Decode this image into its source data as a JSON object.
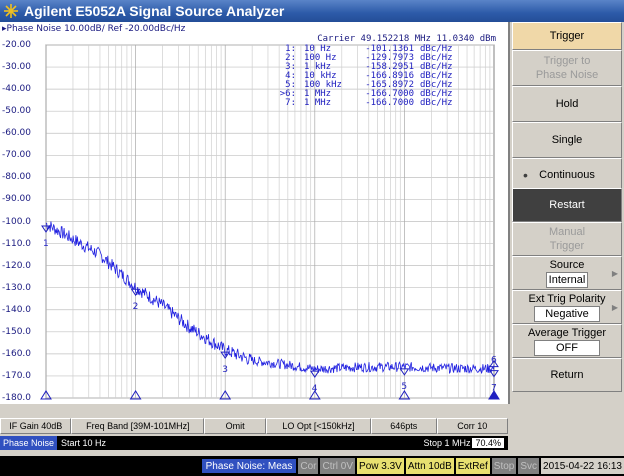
{
  "window": {
    "title": "Agilent E5052A Signal Source Analyzer"
  },
  "plot": {
    "header": "▸Phase Noise 10.00dB/ Ref -20.00dBc/Hz",
    "carrier": "Carrier 49.152218 MHz     11.0340 dBm",
    "y_ticks": [
      "-20.00",
      "-30.00",
      "-40.00",
      "-50.00",
      "-60.00",
      "-70.00",
      "-80.00",
      "-90.00",
      "-100.0",
      "-110.0",
      "-120.0",
      "-130.0",
      "-140.0",
      "-150.0",
      "-160.0",
      "-170.0",
      "-180.0"
    ],
    "markers": [
      {
        "id": "1:",
        "freq": "10 Hz",
        "val": "-101.1361",
        "unit": "dBc/Hz",
        "label": "1"
      },
      {
        "id": "2:",
        "freq": "100 Hz",
        "val": "-129.7973",
        "unit": "dBc/Hz",
        "label": "2"
      },
      {
        "id": "3:",
        "freq": "1 kHz",
        "val": "-158.2951",
        "unit": "dBc/Hz",
        "label": "3"
      },
      {
        "id": "4:",
        "freq": "10 kHz",
        "val": "-166.8916",
        "unit": "dBc/Hz",
        "label": "4"
      },
      {
        "id": "5:",
        "freq": "100 kHz",
        "val": "-165.8972",
        "unit": "dBc/Hz",
        "label": "5"
      },
      {
        "id": ">6:",
        "freq": "1 MHz",
        "val": "-166.7000",
        "unit": "dBc/Hz",
        "label": "6"
      },
      {
        "id": "7:",
        "freq": "1 MHz",
        "val": "-166.7000",
        "unit": "dBc/Hz",
        "label": "7"
      }
    ]
  },
  "chart_data": {
    "type": "line",
    "x_scale": "log",
    "xlim": [
      10,
      1000000
    ],
    "ylim": [
      -180,
      -20
    ],
    "ylabel": "dBc/Hz",
    "series": [
      {
        "x": [
          10,
          20,
          40,
          100,
          200,
          400,
          1000,
          2000,
          5000,
          10000,
          30000,
          100000,
          300000,
          1000000
        ],
        "y": [
          -101,
          -108,
          -115,
          -129.8,
          -138,
          -148,
          -158.3,
          -163,
          -165,
          -166.9,
          -166,
          -165.9,
          -166.5,
          -166.7
        ]
      }
    ],
    "marker_points": [
      {
        "label": "1",
        "x": 10,
        "y": -101.1361
      },
      {
        "label": "2",
        "x": 100,
        "y": -129.7973
      },
      {
        "label": "3",
        "x": 1000,
        "y": -158.2951
      },
      {
        "label": "4",
        "x": 10000,
        "y": -166.8916
      },
      {
        "label": "5",
        "x": 100000,
        "y": -165.8972
      },
      {
        "label": "6",
        "x": 1000000,
        "y": -166.7
      },
      {
        "label": "7",
        "x": 1000000,
        "y": -166.7
      }
    ]
  },
  "status1": {
    "if_gain": "IF Gain 40dB",
    "freq_band": "Freq Band [39M-101MHz]",
    "omit": "Omit",
    "lo_opt": "LO Opt [<150kHz]",
    "pts": "646pts",
    "corr": "Corr 10"
  },
  "status2": {
    "channel": "Phase Noise",
    "start": "Start 10 Hz",
    "stop": "Stop 1 MHz",
    "pct": "70.4%"
  },
  "status3": {
    "meas": "Phase Noise: Meas",
    "cor": "Cor",
    "ctrl": "Ctrl 0V",
    "pow": "Pow  3.3V",
    "attn": "Attn 10dB",
    "extref": "ExtRef",
    "stop": "Stop",
    "svc": "Svc",
    "datetime": "2015-04-22 16:13"
  },
  "panel": {
    "trigger": "Trigger",
    "trigger_pn_1": "Trigger to",
    "trigger_pn_2": "Phase Noise",
    "hold": "Hold",
    "single": "Single",
    "continuous": "Continuous",
    "restart": "Restart",
    "manual_1": "Manual",
    "manual_2": "Trigger",
    "source": "Source",
    "source_val": "Internal",
    "polarity": "Ext Trig Polarity",
    "polarity_val": "Negative",
    "avg": "Average Trigger",
    "avg_val": "OFF",
    "return": "Return"
  }
}
